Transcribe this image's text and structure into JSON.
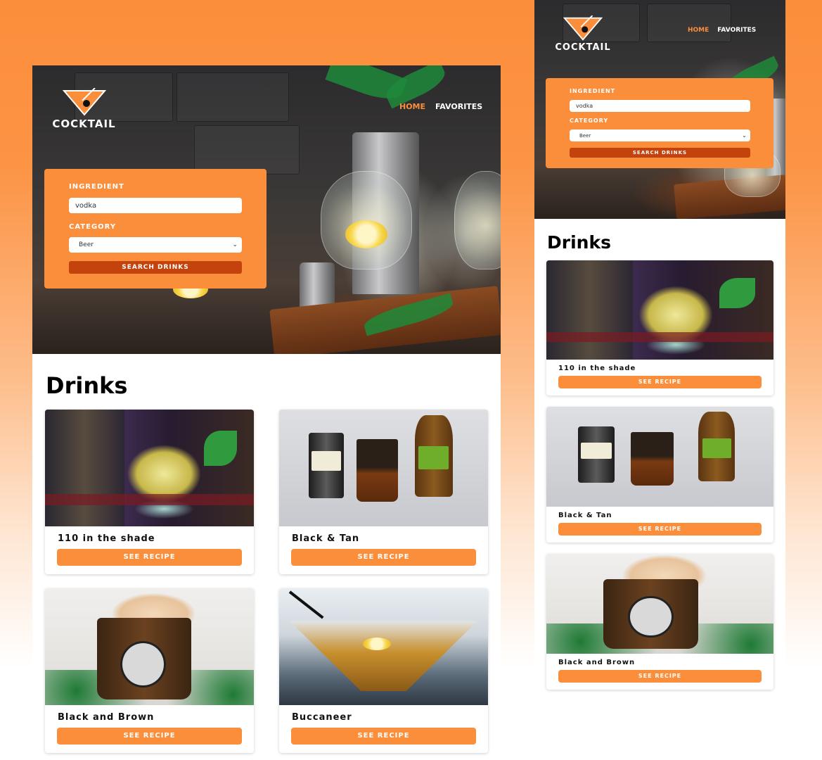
{
  "brand": {
    "name": "COCKTAIL"
  },
  "nav": {
    "home": "HOME",
    "favorites": "FAVORITES"
  },
  "search": {
    "ingredient_label": "INGREDIENT",
    "ingredient_value": "vodka",
    "category_label": "CATEGORY",
    "category_value": "Beer",
    "button": "SEARCH DRINKS"
  },
  "drinks": {
    "title": "Drinks",
    "button_label": "SEE RECIPE",
    "items": [
      {
        "name": "110 in the shade"
      },
      {
        "name": "Black & Tan"
      },
      {
        "name": "Black and Brown"
      },
      {
        "name": "Buccaneer"
      }
    ]
  },
  "colors": {
    "accent": "#fb8e3b",
    "search_button": "#c4420c",
    "nav_active": "#fb8e3b"
  }
}
